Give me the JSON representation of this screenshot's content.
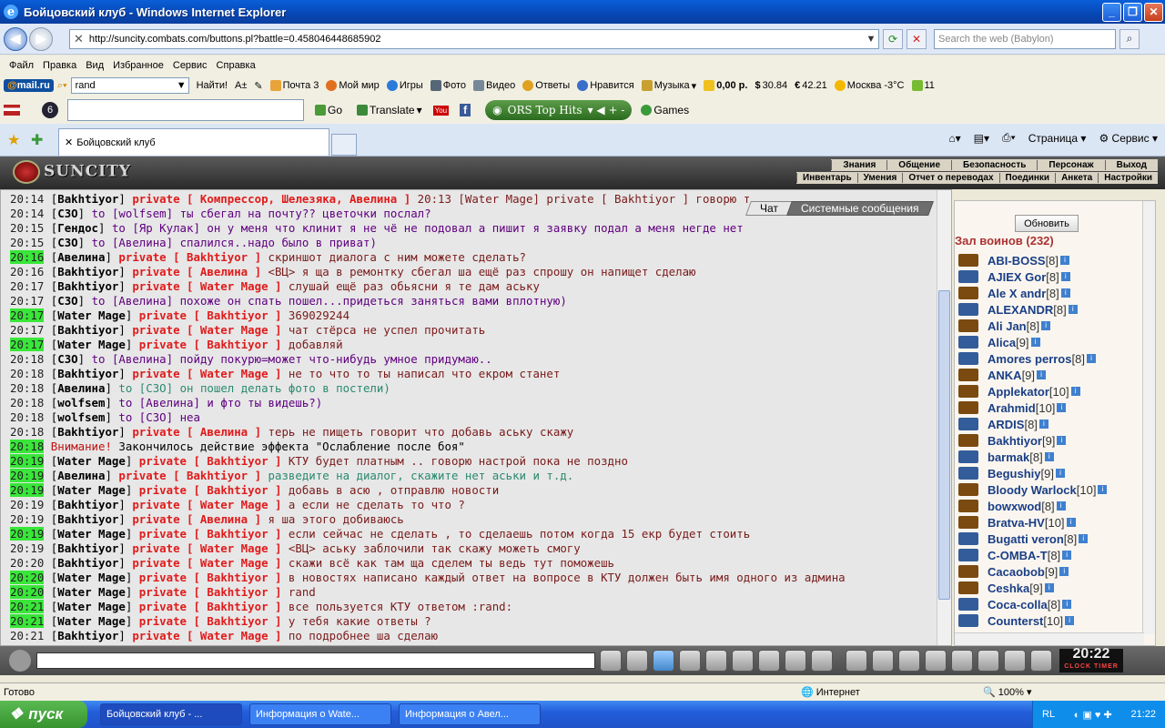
{
  "window": {
    "title": "Бойцовский клуб - Windows Internet Explorer"
  },
  "address": {
    "url": "http://suncity.combats.com/buttons.pl?battle=0.458046448685902",
    "search_placeholder": "Search the web (Babylon)"
  },
  "menubar": [
    "Файл",
    "Правка",
    "Вид",
    "Избранное",
    "Сервис",
    "Справка"
  ],
  "toolbar1": {
    "mail_logo_a": "@",
    "mail_logo_b": "mail.ru",
    "search_value": "rand",
    "find_label": "Найти!",
    "mail": "Почта 3",
    "my_world": "Мой мир",
    "games": "Игры",
    "photo": "Фото",
    "video": "Видео",
    "answers": "Ответы",
    "likes": "Нравится",
    "music": "Музыка",
    "money": "0,00 р.",
    "usd": "30.84",
    "eur": "42.21",
    "weather": "Москва -3°C",
    "count": "11"
  },
  "toolbar2": {
    "go_label": "Go",
    "translate_label": "Translate",
    "ors_label": "ORS Top Hits",
    "games_label": "Games"
  },
  "tab": {
    "label": "Бойцовский клуб",
    "page_menu": "Страница",
    "tools_menu": "Сервис"
  },
  "game": {
    "logo": "SUNCITY",
    "menu_top": [
      "Знания",
      "Общение",
      "Безопасность",
      "Персонаж",
      "Выход"
    ],
    "menu_bottom": [
      "Инвентарь",
      "Умения",
      "Отчет о переводах",
      "Поединки",
      "Анкета",
      "Настройки"
    ],
    "chat_tab": "Чат",
    "system_tab": "Системные сообщения"
  },
  "chat": [
    {
      "time": "20:14",
      "hl": false,
      "who": "Bakhtiyor",
      "kind": "priv",
      "target": "private [ Компрессор, Шелезяка, Авелина ]",
      "text": "20:13 [Water Mage] private [ Bakhtiyor ] говорю т"
    },
    {
      "time": "20:14",
      "hl": false,
      "who": "СЗО",
      "kind": "to",
      "target": "to [wolfsem]",
      "text": "ты сбегал на почту?? цветочки послал?"
    },
    {
      "time": "20:15",
      "hl": false,
      "who": "Гендос",
      "kind": "to",
      "target": "to [Яр Кулак]",
      "text": "он у меня что клинит я не чё не подовал а пишит я заявку подал а меня негде нет"
    },
    {
      "time": "20:15",
      "hl": false,
      "who": "СЗО",
      "kind": "to",
      "target": "to [Авелина]",
      "text": "спалился..надо было в приват)"
    },
    {
      "time": "20:16",
      "hl": true,
      "who": "Авелина",
      "kind": "priv",
      "target": "private [ Bakhtiyor ]",
      "text": "скриншот диалога с ним можете сделать?"
    },
    {
      "time": "20:16",
      "hl": false,
      "who": "Bakhtiyor",
      "kind": "priv",
      "target": "private [ Авелина ]",
      "text": "<ВЦ> я ща в ремонтку сбегал ша ещё раз спрошу он напищет сделаю"
    },
    {
      "time": "20:17",
      "hl": false,
      "who": "Bakhtiyor",
      "kind": "priv",
      "target": "private [ Water Mage ]",
      "text": "слушай ещё раз обьясни я те дам аську"
    },
    {
      "time": "20:17",
      "hl": false,
      "who": "СЗО",
      "kind": "to",
      "target": "to [Авелина]",
      "text": "похоже он спать пошел...придеться заняться вами вплотную)"
    },
    {
      "time": "20:17",
      "hl": true,
      "who": "Water Mage",
      "kind": "priv",
      "target": "private [ Bakhtiyor ]",
      "text": "369029244"
    },
    {
      "time": "20:17",
      "hl": false,
      "who": "Bakhtiyor",
      "kind": "priv",
      "target": "private [ Water Mage ]",
      "text": "чат стёрса не успел прочитать"
    },
    {
      "time": "20:17",
      "hl": true,
      "who": "Water Mage",
      "kind": "priv",
      "target": "private [ Bakhtiyor ]",
      "text": "добавляй"
    },
    {
      "time": "20:18",
      "hl": false,
      "who": "СЗО",
      "kind": "to",
      "target": "to [Авелина]",
      "text": "пойду покурю=может что-нибудь умное придумаю.."
    },
    {
      "time": "20:18",
      "hl": false,
      "who": "Bakhtiyor",
      "kind": "priv",
      "target": "private [ Water Mage ]",
      "text": "не то что то ты написал что екром станет"
    },
    {
      "time": "20:18",
      "hl": false,
      "who": "Авелина",
      "kind": "to-teal",
      "target": "to [СЗО]",
      "text": "он пошел делать фото в постели)"
    },
    {
      "time": "20:18",
      "hl": false,
      "who": "wolfsem",
      "kind": "to",
      "target": "to [Авелина]",
      "text": "и фто ты видешь?)"
    },
    {
      "time": "20:18",
      "hl": false,
      "who": "wolfsem",
      "kind": "to",
      "target": "to [СЗО]",
      "text": "неа"
    },
    {
      "time": "20:18",
      "hl": false,
      "who": "Bakhtiyor",
      "kind": "priv",
      "target": "private [ Авелина ]",
      "text": "терь не пищеть говорит что добавь аську скажу"
    },
    {
      "time": "20:18",
      "hl": true,
      "who": "",
      "kind": "sys",
      "target": "Внимание!",
      "text": "Закончилось действие эффекта \"Ослабление после боя\""
    },
    {
      "time": "20:19",
      "hl": true,
      "who": "Water Mage",
      "kind": "priv",
      "target": "private [ Bakhtiyor ]",
      "text": "КТУ будет платным .. говорю настрой пока не поздно"
    },
    {
      "time": "20:19",
      "hl": true,
      "who": "Авелина",
      "kind": "priv-teal",
      "target": "private [ Bakhtiyor ]",
      "text": "разведите на диалог, скажите нет аськи и т.д."
    },
    {
      "time": "20:19",
      "hl": true,
      "who": "Water Mage",
      "kind": "priv",
      "target": "private [ Bakhtiyor ]",
      "text": "добавь в асю , отправлю новости"
    },
    {
      "time": "20:19",
      "hl": false,
      "who": "Bakhtiyor",
      "kind": "priv",
      "target": "private [ Water Mage ]",
      "text": "а если не сделать то что ?"
    },
    {
      "time": "20:19",
      "hl": false,
      "who": "Bakhtiyor",
      "kind": "priv",
      "target": "private [ Авелина ]",
      "text": "я ша этого добиваюсь"
    },
    {
      "time": "20:19",
      "hl": true,
      "who": "Water Mage",
      "kind": "priv",
      "target": "private [ Bakhtiyor ]",
      "text": "если сейчас не сделать , то сделаешь потом когда 15 екр будет стоить"
    },
    {
      "time": "20:19",
      "hl": false,
      "who": "Bakhtiyor",
      "kind": "priv",
      "target": "private [ Water Mage ]",
      "text": "<ВЦ> аську заблочили так скажу можеть смогу"
    },
    {
      "time": "20:20",
      "hl": false,
      "who": "Bakhtiyor",
      "kind": "priv",
      "target": "private [ Water Mage ]",
      "text": "скажи всё как там ща сделем ты ведь тут поможешь"
    },
    {
      "time": "20:20",
      "hl": true,
      "who": "Water Mage",
      "kind": "priv",
      "target": "private [ Bakhtiyor ]",
      "text": "в новостях написано каждый ответ на вопросе в КТУ должен быть имя одного из админа"
    },
    {
      "time": "20:20",
      "hl": true,
      "who": "Water Mage",
      "kind": "priv",
      "target": "private [ Bakhtiyor ]",
      "text": "rand"
    },
    {
      "time": "20:21",
      "hl": true,
      "who": "Water Mage",
      "kind": "priv",
      "target": "private [ Bakhtiyor ]",
      "text": "все пользуется КТУ ответом :rand:"
    },
    {
      "time": "20:21",
      "hl": true,
      "who": "Water Mage",
      "kind": "priv",
      "target": "private [ Bakhtiyor ]",
      "text": "у тебя какие ответы ?"
    },
    {
      "time": "20:21",
      "hl": false,
      "who": "Bakhtiyor",
      "kind": "priv",
      "target": "private [ Water Mage ]",
      "text": "по подробнее ша сделаю"
    }
  ],
  "side": {
    "refresh_label": "Обновить",
    "hall": "Зал воинов (232)",
    "players": [
      {
        "name": "ABI-BOSS",
        "lvl": "[8]"
      },
      {
        "name": "AJIEX Gor",
        "lvl": "[8]"
      },
      {
        "name": "Ale X andr",
        "lvl": "[8]"
      },
      {
        "name": "ALEXANDR",
        "lvl": "[8]"
      },
      {
        "name": "Ali Jan",
        "lvl": "[8]"
      },
      {
        "name": "Alica",
        "lvl": "[9]"
      },
      {
        "name": "Amores perros",
        "lvl": "[8]"
      },
      {
        "name": "ANKA",
        "lvl": "[9]"
      },
      {
        "name": "Applekator",
        "lvl": "[10]"
      },
      {
        "name": "Arahmid",
        "lvl": "[10]"
      },
      {
        "name": "ARDIS",
        "lvl": "[8]"
      },
      {
        "name": "Bakhtiyor",
        "lvl": "[9]"
      },
      {
        "name": "barmak",
        "lvl": "[8]"
      },
      {
        "name": "Begushiy",
        "lvl": "[9]"
      },
      {
        "name": "Bloody Warlock",
        "lvl": "[10]"
      },
      {
        "name": "bowxwod",
        "lvl": "[8]"
      },
      {
        "name": "Bratva-HV",
        "lvl": "[10]"
      },
      {
        "name": "Bugatti veron",
        "lvl": "[8]"
      },
      {
        "name": "C-OMBA-T",
        "lvl": "[8]"
      },
      {
        "name": "Cacaobob",
        "lvl": "[9]"
      },
      {
        "name": "Ceshka",
        "lvl": "[9]"
      },
      {
        "name": "Coca-colla",
        "lvl": "[8]"
      },
      {
        "name": "Counterst",
        "lvl": "[10]"
      }
    ]
  },
  "clock": {
    "time": "20:22",
    "label": "CLOCK TIMER"
  },
  "status": {
    "left": "Готово",
    "zone": "Интернет",
    "zoom": "100%"
  },
  "taskbar": {
    "start": "пуск",
    "tasks": [
      "Бойцовский клуб - ...",
      "Информация о Wate...",
      "Информация о Авел..."
    ],
    "lang": "RL",
    "time": "21:22"
  }
}
